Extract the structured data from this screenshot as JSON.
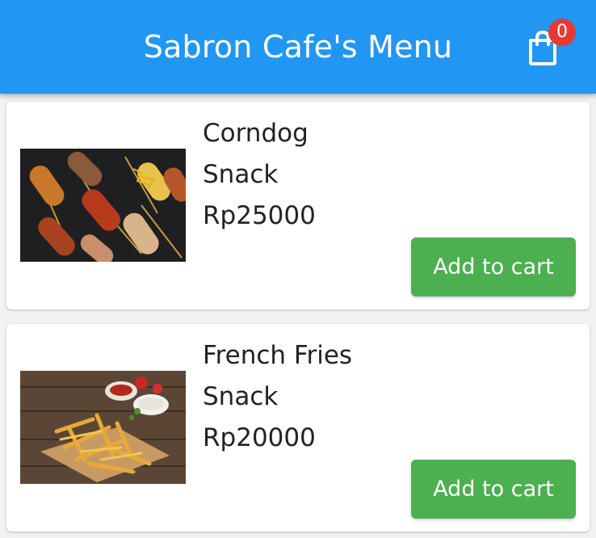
{
  "appbar": {
    "title": "Sabron Cafe's Menu",
    "cart_count": "0"
  },
  "colors": {
    "primary": "#2196f3",
    "badge": "#e53935",
    "add_button": "#4caf50"
  },
  "icons": {
    "cart": "shopping-bag-icon"
  },
  "menu_items": [
    {
      "name": "Corndog",
      "category": "Snack",
      "price": "Rp25000",
      "button_label": "Add to cart",
      "image": "corndog-photo"
    },
    {
      "name": "French Fries",
      "category": "Snack",
      "price": "Rp20000",
      "button_label": "Add to cart",
      "image": "french-fries-photo"
    }
  ]
}
